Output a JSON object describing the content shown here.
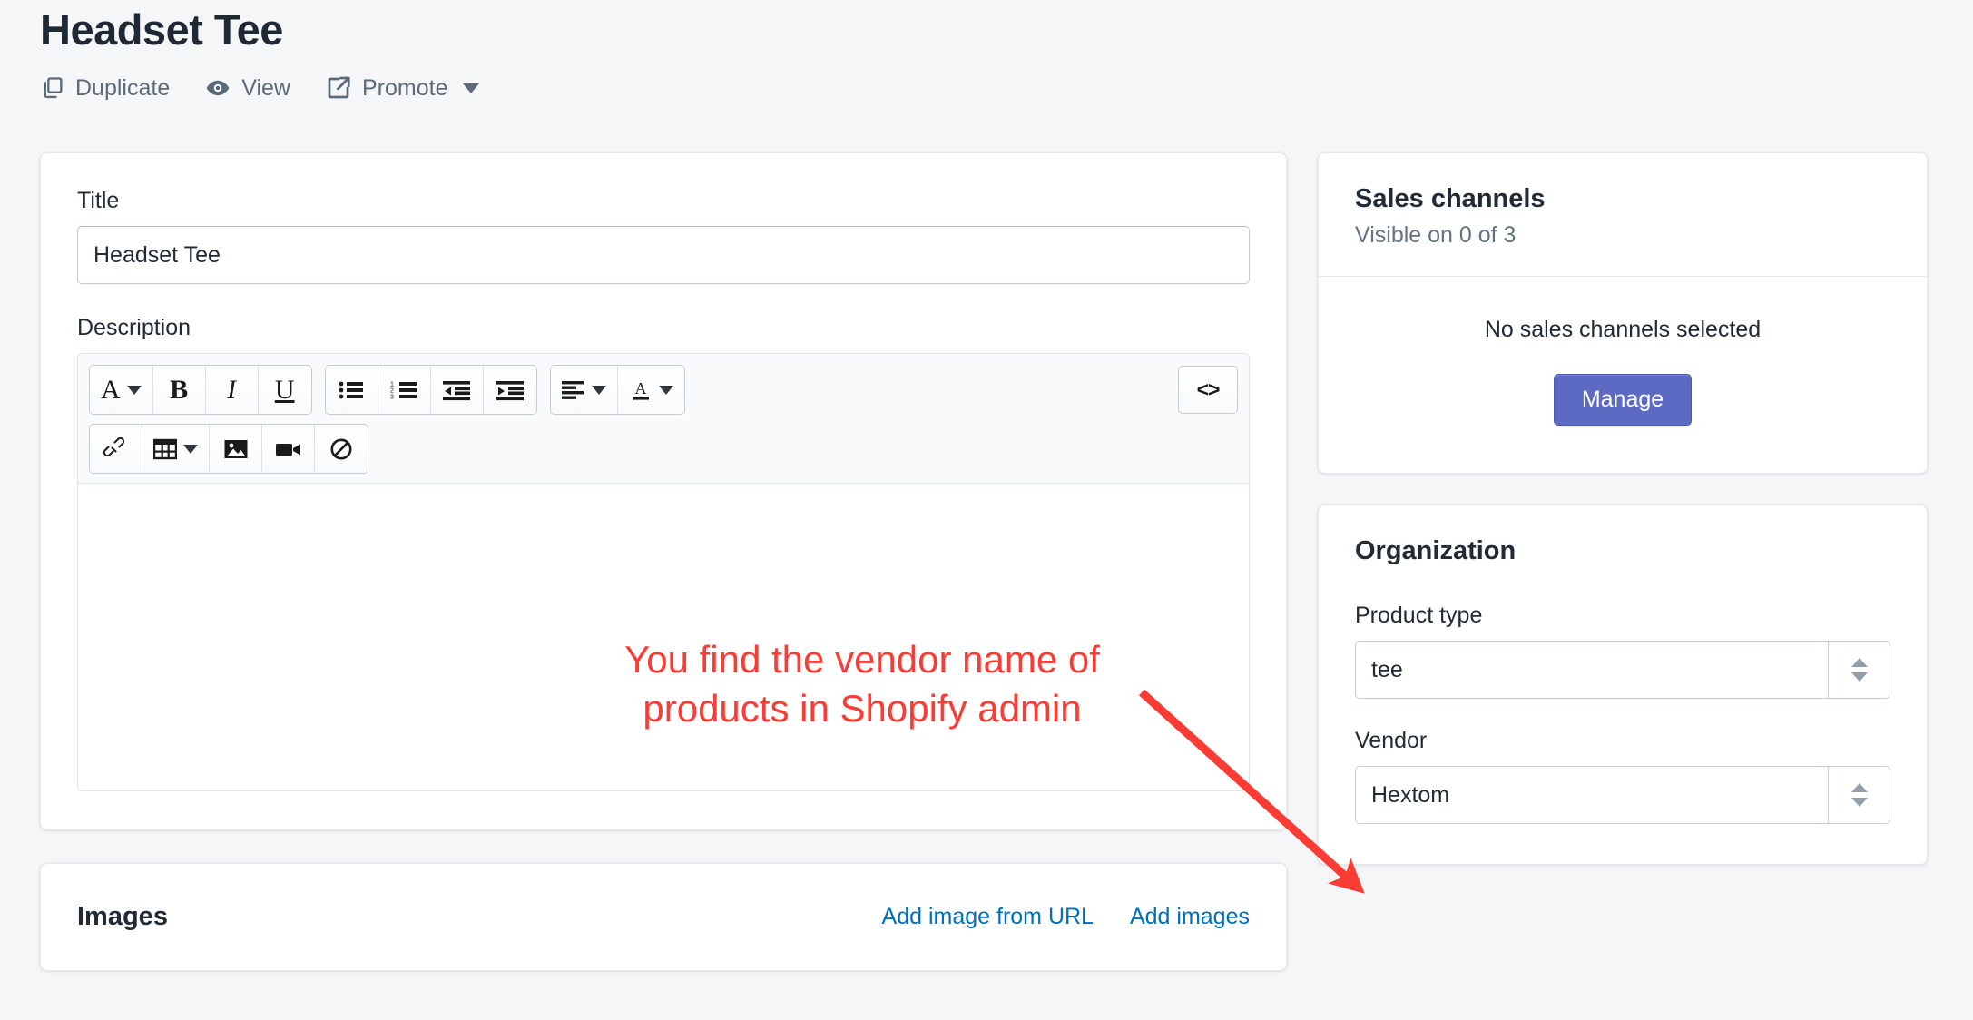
{
  "header": {
    "title": "Headset Tee",
    "actions": [
      {
        "label": "Duplicate",
        "icon": "duplicate-icon"
      },
      {
        "label": "View",
        "icon": "eye-icon"
      },
      {
        "label": "Promote",
        "icon": "external-link-icon",
        "has_caret": true
      }
    ]
  },
  "product": {
    "title_label": "Title",
    "title_value": "Headset Tee",
    "description_label": "Description",
    "description_value": "",
    "toolbar": {
      "row1": [
        {
          "name": "font-style-dropdown",
          "glyph": "A",
          "caret": true
        },
        {
          "name": "bold-button",
          "glyph": "B"
        },
        {
          "name": "italic-button",
          "glyph": "I"
        },
        {
          "name": "underline-button",
          "glyph": "U"
        },
        {
          "name": "bullet-list-button"
        },
        {
          "name": "numbered-list-button"
        },
        {
          "name": "outdent-button"
        },
        {
          "name": "indent-button"
        },
        {
          "name": "align-dropdown",
          "caret": true
        },
        {
          "name": "text-color-dropdown",
          "glyph": "A",
          "caret": true
        }
      ],
      "row2": [
        {
          "name": "insert-link-button"
        },
        {
          "name": "insert-table-dropdown",
          "caret": true
        },
        {
          "name": "insert-image-button"
        },
        {
          "name": "insert-video-button"
        },
        {
          "name": "clear-formatting-button"
        }
      ],
      "code_label": "<>"
    }
  },
  "images": {
    "title": "Images",
    "add_from_url_label": "Add image from URL",
    "add_images_label": "Add images"
  },
  "sales_channels": {
    "title": "Sales channels",
    "subtitle": "Visible on 0 of 3",
    "empty_text": "No sales channels selected",
    "manage_label": "Manage"
  },
  "organization": {
    "title": "Organization",
    "product_type_label": "Product type",
    "product_type_value": "tee",
    "vendor_label": "Vendor",
    "vendor_value": "Hextom"
  },
  "annotation": {
    "line1": "You find the vendor name of",
    "line2": "products in Shopify admin",
    "color": "#fa3c34"
  }
}
